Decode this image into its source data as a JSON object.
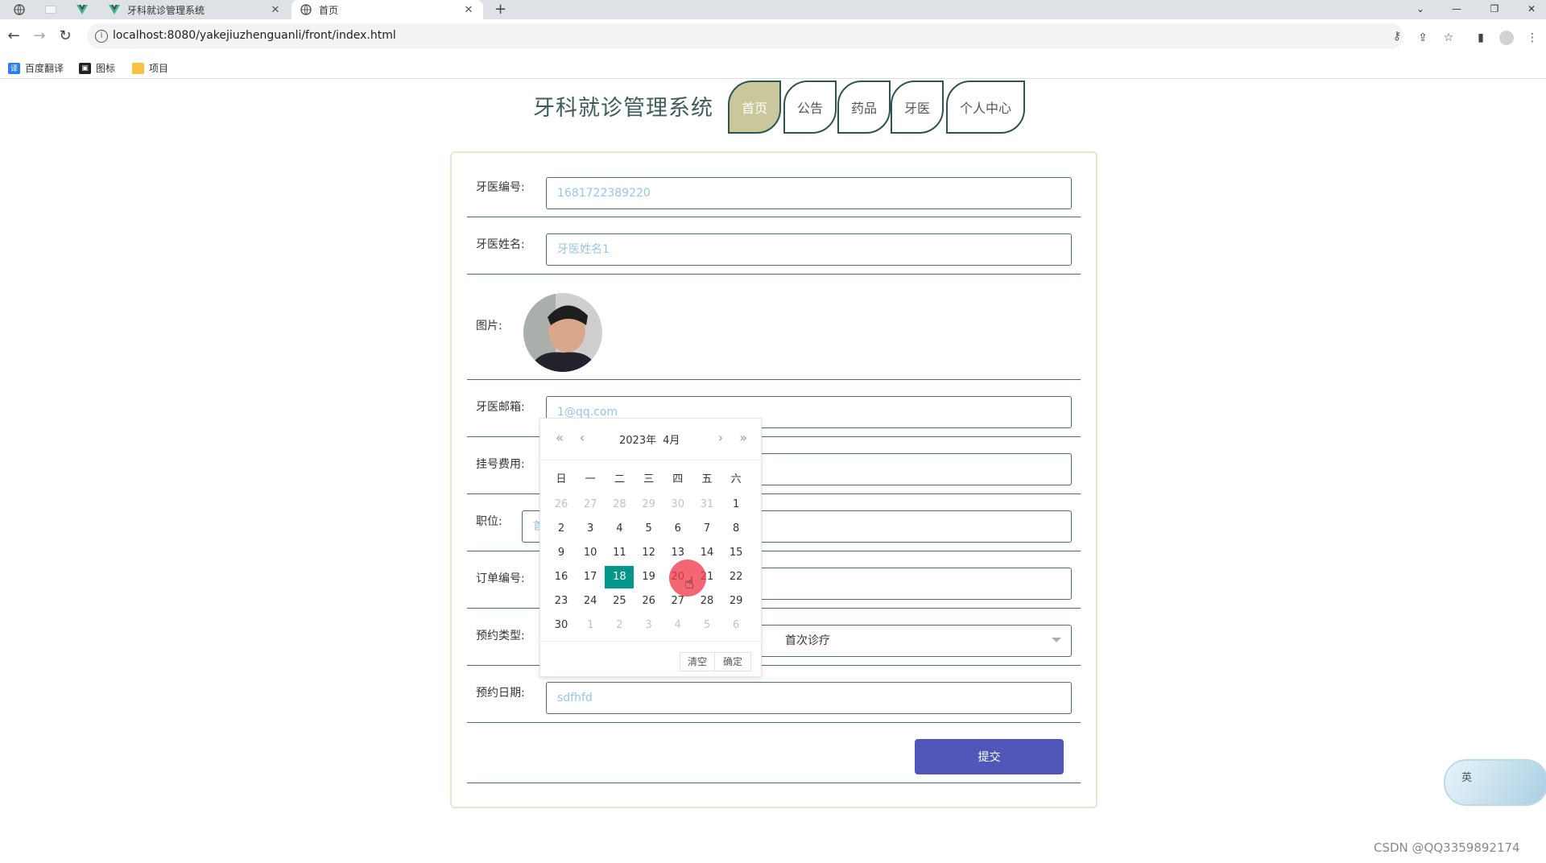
{
  "browser": {
    "tabs": [
      {
        "title": "牙科就诊管理系统",
        "active": false
      },
      {
        "title": "首页",
        "active": true
      }
    ],
    "new_tab_label": "+",
    "url": "localhost:8080/yakejiuzhenguanli/front/index.html",
    "bookmarks": [
      {
        "label": "百度翻译",
        "icon": "translate-icon",
        "color": "#2b7de9"
      },
      {
        "label": "图标",
        "icon": "image-icon",
        "color": "#222222"
      },
      {
        "label": "项目",
        "icon": "folder-icon",
        "color": "#f6c344"
      }
    ]
  },
  "header": {
    "site_title": "牙科就诊管理系统",
    "nav": [
      {
        "label": "首页",
        "active": true
      },
      {
        "label": "公告",
        "active": false
      },
      {
        "label": "药品",
        "active": false
      },
      {
        "label": "牙医",
        "active": false
      },
      {
        "label": "个人中心",
        "active": false
      }
    ]
  },
  "form": {
    "dentist_id": {
      "label": "牙医编号:",
      "value": "1681722389220"
    },
    "dentist_name": {
      "label": "牙医姓名:",
      "value": "牙医姓名1"
    },
    "photo": {
      "label": "图片:"
    },
    "email": {
      "label": "牙医邮箱:",
      "value": "1@qq.com"
    },
    "fee": {
      "label": "挂号费用:",
      "value": ""
    },
    "position": {
      "label": "职位:",
      "value": "首"
    },
    "order_no": {
      "label": "订单编号:",
      "value": ""
    },
    "appt_type": {
      "label": "预约类型:",
      "value": "首次诊疗"
    },
    "appt_date": {
      "label": "预约日期:",
      "value": "sdfhfd"
    },
    "submit_label": "提交"
  },
  "datepicker": {
    "year": "2023年",
    "month": "4月",
    "weekdays": [
      "日",
      "一",
      "二",
      "三",
      "四",
      "五",
      "六"
    ],
    "days": [
      [
        "26",
        "27",
        "28",
        "29",
        "30",
        "31",
        "1"
      ],
      [
        "2",
        "3",
        "4",
        "5",
        "6",
        "7",
        "8"
      ],
      [
        "9",
        "10",
        "11",
        "12",
        "13",
        "14",
        "15"
      ],
      [
        "16",
        "17",
        "18",
        "19",
        "20",
        "21",
        "22"
      ],
      [
        "23",
        "24",
        "25",
        "26",
        "27",
        "28",
        "29"
      ],
      [
        "30",
        "1",
        "2",
        "3",
        "4",
        "5",
        "6"
      ]
    ],
    "selected": "18",
    "clear_label": "清空",
    "confirm_label": "确定"
  },
  "float_widget": {
    "label": "英"
  },
  "watermark": "CSDN @QQ3359892174",
  "colors": {
    "accent_teal": "#009688",
    "submit_blue": "#4f58b8",
    "nav_active": "#c8c89a",
    "border_dark": "#2e5350"
  }
}
